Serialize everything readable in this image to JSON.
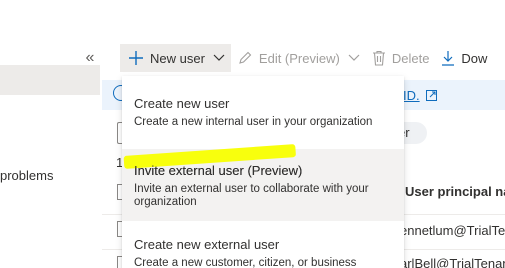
{
  "nav": {
    "collapse_glyph": "«",
    "problems_label": "problems"
  },
  "toolbar": {
    "new_user_label": "New user",
    "edit_label": "Edit (Preview)",
    "delete_label": "Delete",
    "download_label": "Dow"
  },
  "info": {
    "link_label": "ID."
  },
  "list": {
    "filter_pill_label": "er",
    "count_fragment": "1",
    "column_upn": "User principal na",
    "rows": [
      "ennetlum@TrialTen",
      "arlBell@TrialTenan"
    ]
  },
  "menu": {
    "items": [
      {
        "title": "Create new user",
        "desc": "Create a new internal user in your organization"
      },
      {
        "title": "Invite external user (Preview)",
        "desc": "Invite an external user to collaborate with your organization"
      },
      {
        "title": "Create new external user",
        "desc": "Create a new customer, citizen, or business"
      }
    ]
  },
  "colors": {
    "accent": "#0f6cbd",
    "highlight": "#f8ff00",
    "hover": "#f3f2f1"
  }
}
